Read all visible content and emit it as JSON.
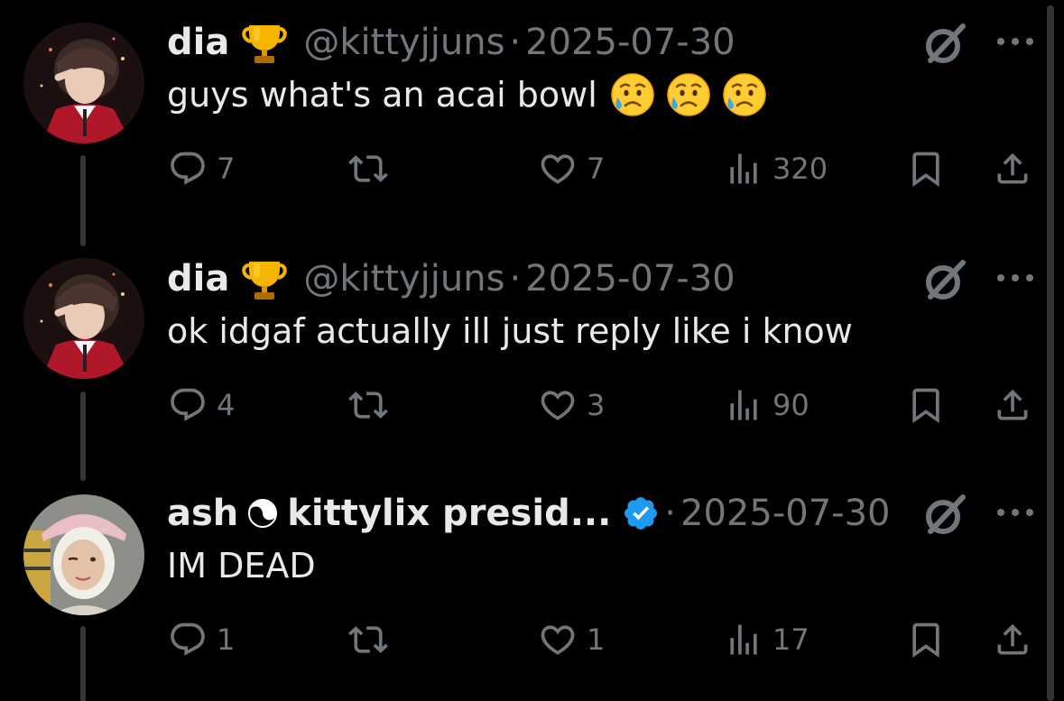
{
  "tweets": [
    {
      "name": "dia",
      "handle": "@kittyjjuns",
      "date": "2025-07-30",
      "text": "guys what's an acai bowl",
      "replies": "7",
      "likes": "7",
      "views": "320"
    },
    {
      "name": "dia",
      "handle": "@kittyjjuns",
      "date": "2025-07-30",
      "text": "ok idgaf actually ill just reply like i know",
      "replies": "4",
      "likes": "3",
      "views": "90"
    },
    {
      "name_part1": "ash",
      "name_part2": "kittylix presid...",
      "date": "2025-07-30",
      "text": "IM DEAD",
      "replies": "1",
      "likes": "1",
      "views": "17"
    }
  ],
  "dot_separator": "·",
  "colors": {
    "background": "#000000",
    "text_primary": "#e7e9ea",
    "text_secondary": "#71767b",
    "verified_blue": "#1d9bf0",
    "thread_line": "#333639"
  },
  "icons": [
    "trophy-icon",
    "sad-sweat-emoji",
    "yin-yang-icon",
    "verified-badge-icon",
    "grok-icon",
    "more-icon",
    "reply-icon",
    "retweet-icon",
    "like-icon",
    "views-icon",
    "bookmark-icon",
    "share-icon"
  ]
}
